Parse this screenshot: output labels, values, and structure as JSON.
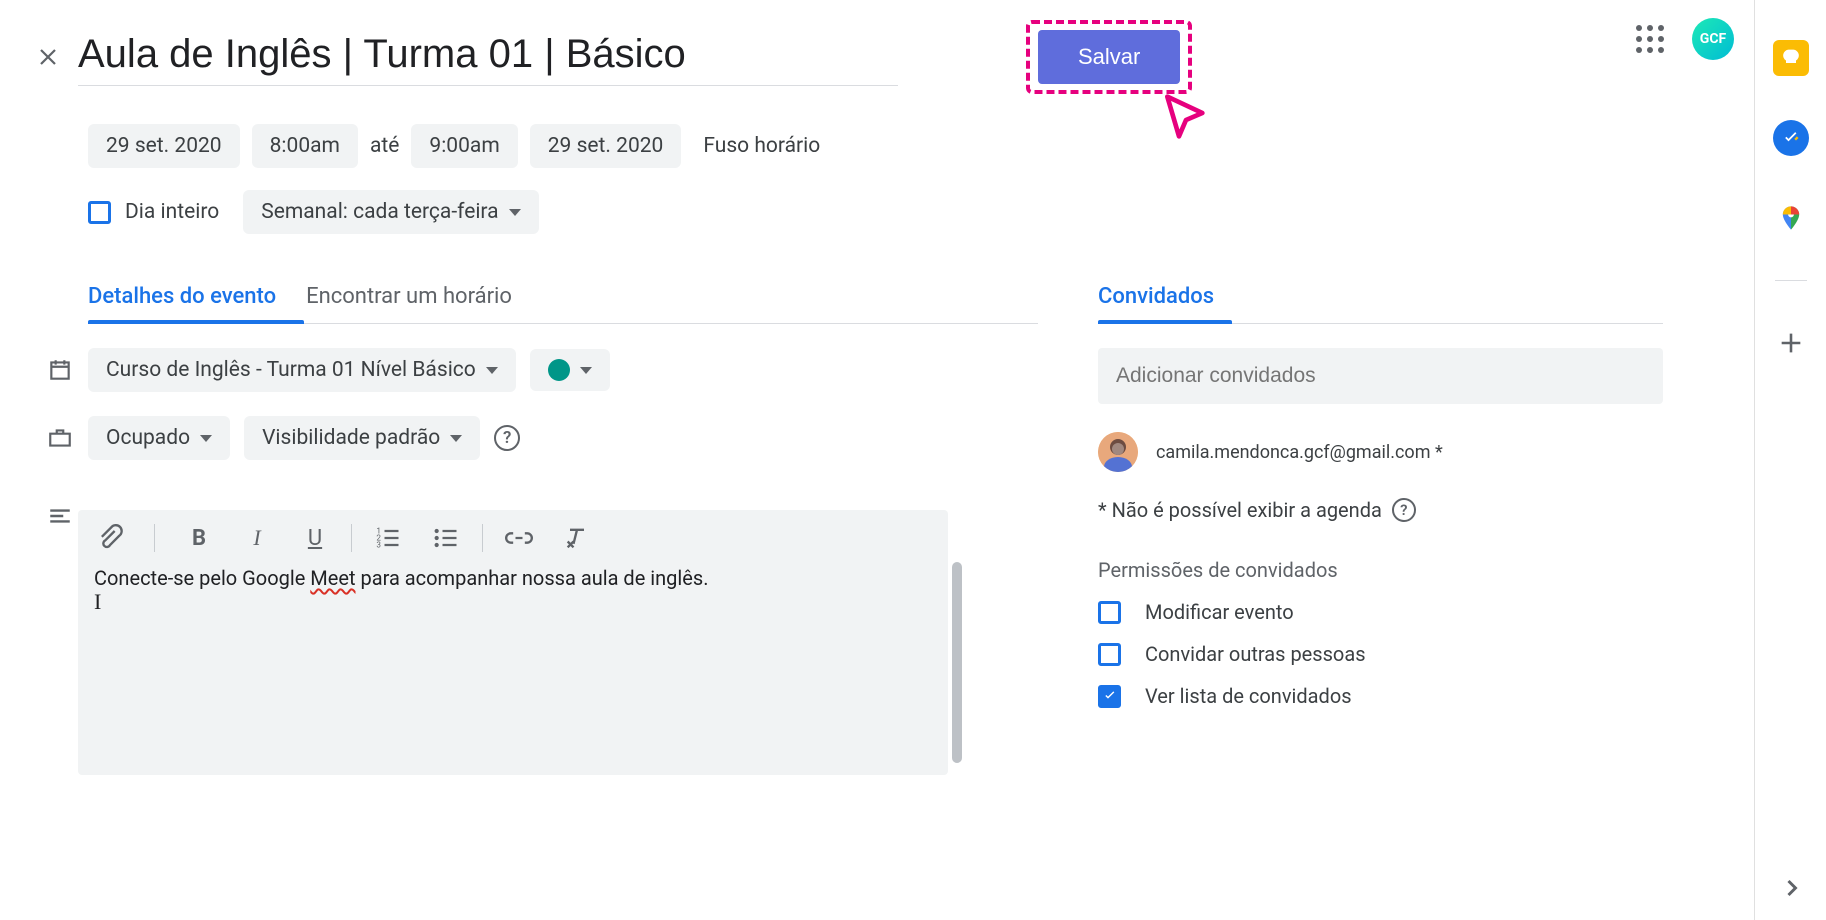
{
  "header": {
    "title": "Aula de Inglês | Turma 01 | Básico",
    "save_label": "Salvar",
    "profile_badge": "GCF"
  },
  "datetime": {
    "start_date": "29 set. 2020",
    "start_time": "8:00am",
    "to_label": "até",
    "end_time": "9:00am",
    "end_date": "29 set. 2020",
    "timezone_label": "Fuso horário",
    "all_day_label": "Dia inteiro",
    "all_day_checked": false,
    "recurrence_label": "Semanal: cada terça-feira"
  },
  "tabs": {
    "details": "Detalhes do evento",
    "find_time": "Encontrar um horário",
    "guests": "Convidados"
  },
  "details": {
    "calendar_name": "Curso de Inglês - Turma 01 Nível Básico",
    "calendar_color": "#009688",
    "availability": "Ocupado",
    "visibility": "Visibilidade padrão",
    "description": "Conecte-se pelo Google Meet para acompanhar nossa aula de inglês.",
    "description_misspelled_word": "Meet"
  },
  "guests": {
    "add_placeholder": "Adicionar convidados",
    "list": [
      {
        "email": "camila.mendonca.gcf@gmail.com",
        "suffix": " *"
      }
    ],
    "calendar_note": "* Não é possível exibir a agenda",
    "permissions_title": "Permissões de convidados",
    "permissions": [
      {
        "label": "Modificar evento",
        "checked": false
      },
      {
        "label": "Convidar outras pessoas",
        "checked": false
      },
      {
        "label": "Ver lista de convidados",
        "checked": true
      }
    ]
  },
  "side_panel": {
    "items": [
      "keep",
      "tasks",
      "maps",
      "add"
    ]
  },
  "annotation": {
    "highlight_target": "save-button",
    "cursor_color": "#e6007e"
  }
}
